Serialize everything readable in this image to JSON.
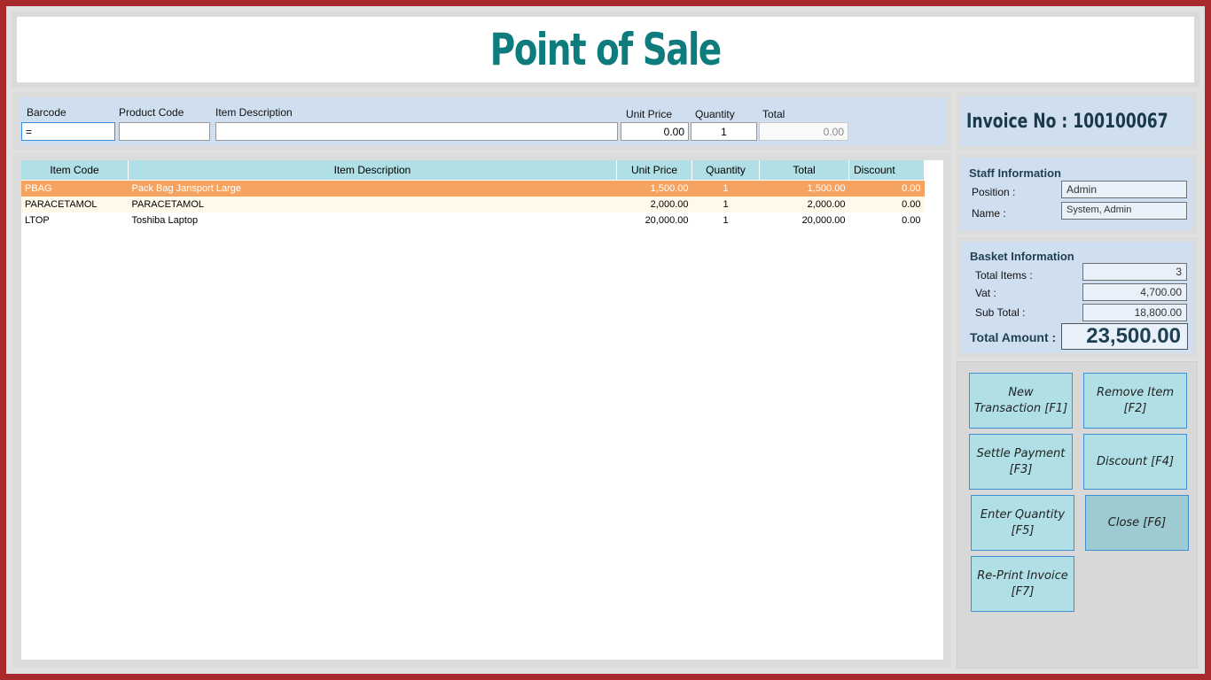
{
  "header": {
    "title": "Point of Sale"
  },
  "entry": {
    "barcode": {
      "label": "Barcode",
      "value": "="
    },
    "product_code": {
      "label": "Product Code",
      "value": ""
    },
    "item_description": {
      "label": "Item Description",
      "value": ""
    },
    "unit_price": {
      "label": "Unit Price",
      "value": "0.00"
    },
    "quantity": {
      "label": "Quantity",
      "value": "1"
    },
    "total": {
      "label": "Total",
      "value": "0.00"
    }
  },
  "grid": {
    "columns": [
      "Item Code",
      "Item Description",
      "Unit Price",
      "Quantity",
      "Total",
      "Discount"
    ],
    "rows": [
      {
        "code": "PBAG",
        "description": "Pack Bag Jansport Large",
        "unit_price": "1,500.00",
        "quantity": "1",
        "total": "1,500.00",
        "discount": "0.00"
      },
      {
        "code": "PARACETAMOL",
        "description": "PARACETAMOL",
        "unit_price": "2,000.00",
        "quantity": "1",
        "total": "2,000.00",
        "discount": "0.00"
      },
      {
        "code": "LTOP",
        "description": "Toshiba Laptop",
        "unit_price": "20,000.00",
        "quantity": "1",
        "total": "20,000.00",
        "discount": "0.00"
      }
    ]
  },
  "invoice": {
    "text": "Invoice No : 100100067"
  },
  "staff": {
    "title": "Staff Information",
    "position_label": "Position :",
    "position_value": "Admin",
    "name_label": "Name :",
    "name_value": "System, Admin"
  },
  "basket": {
    "title": "Basket Information",
    "total_items_label": "Total Items :",
    "total_items_value": "3",
    "vat_label": "Vat :",
    "vat_value": "4,700.00",
    "sub_total_label": "Sub Total :",
    "sub_total_value": "18,800.00",
    "total_amount_label": "Total Amount :",
    "total_amount_value": "23,500.00"
  },
  "actions": {
    "new_transaction": {
      "line1": "New",
      "line2": "Transaction [F1]"
    },
    "remove_item": {
      "line1": "Remove Item",
      "line2": "[F2]"
    },
    "settle_payment": {
      "line1": "Settle Payment",
      "line2": "[F3]"
    },
    "discount": {
      "line1": "Discount [F4]"
    },
    "enter_quantity": {
      "line1": "Enter Quantity",
      "line2": "[F5]"
    },
    "close": {
      "line1": "Close [F6]"
    },
    "reprint_invoice": {
      "line1": "Re-Print Invoice",
      "line2": "[F7]"
    }
  },
  "colors": {
    "frame": "#a9292c",
    "title": "#0e7b7d",
    "selected_row": "#f4a460",
    "grid_header": "#b0e0e6",
    "panel": "#d0dff0"
  }
}
